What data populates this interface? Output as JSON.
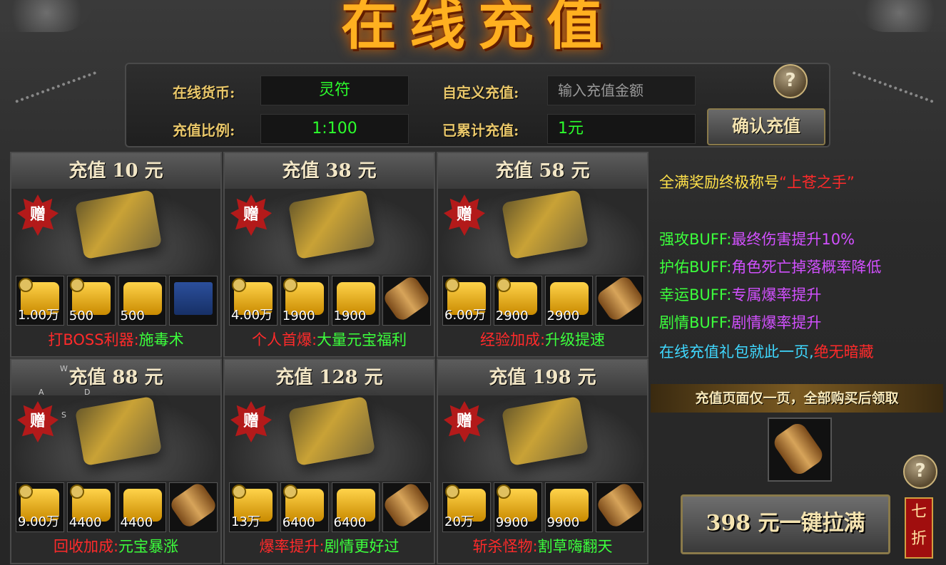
{
  "title": "在线充值",
  "panel": {
    "currency_label": "在线货币:",
    "currency_value": "灵符",
    "ratio_label": "充值比例:",
    "ratio_value": "1:100",
    "custom_label": "自定义充值:",
    "custom_placeholder": "输入充值金额",
    "accum_label": "已累计充值:",
    "accum_value": "1元",
    "confirm_button": "确认充值",
    "help": "?"
  },
  "cards": [
    {
      "title": "充值 10 元",
      "gift": "赠",
      "slots": [
        {
          "icon": "gold-ingot-icon",
          "qty": "1.00万",
          "lock": true
        },
        {
          "icon": "gold-talisman-icon",
          "qty": "500",
          "lock": true
        },
        {
          "icon": "gold-talisman-icon",
          "qty": "500",
          "lock": false
        },
        {
          "icon": "skill-book-icon",
          "qty": "",
          "lock": false
        }
      ],
      "desc_a": "打BOSS利器:",
      "desc_b": "施毒术"
    },
    {
      "title": "充值 38 元",
      "gift": "赠",
      "slots": [
        {
          "icon": "gold-ingot-icon",
          "qty": "4.00万",
          "lock": true
        },
        {
          "icon": "gold-talisman-icon",
          "qty": "1900",
          "lock": true
        },
        {
          "icon": "gold-talisman-icon",
          "qty": "1900",
          "lock": false
        },
        {
          "icon": "scroll-icon",
          "qty": "",
          "lock": false
        }
      ],
      "desc_a": "个人首爆:",
      "desc_b": "大量元宝福利"
    },
    {
      "title": "充值 58 元",
      "gift": "赠",
      "slots": [
        {
          "icon": "gold-ingot-icon",
          "qty": "6.00万",
          "lock": true
        },
        {
          "icon": "gold-talisman-icon",
          "qty": "2900",
          "lock": true
        },
        {
          "icon": "gold-talisman-icon",
          "qty": "2900",
          "lock": false
        },
        {
          "icon": "scroll-icon",
          "qty": "",
          "lock": false
        }
      ],
      "desc_a": "经验加成:",
      "desc_b": "升级提速"
    },
    {
      "title": "充值 88 元",
      "gift": "赠",
      "slots": [
        {
          "icon": "gold-ingot-icon",
          "qty": "9.00万",
          "lock": true
        },
        {
          "icon": "gold-talisman-icon",
          "qty": "4400",
          "lock": true
        },
        {
          "icon": "gold-talisman-icon",
          "qty": "4400",
          "lock": false
        },
        {
          "icon": "scroll-icon",
          "qty": "",
          "lock": false
        }
      ],
      "desc_a": "回收加成:",
      "desc_b": "元宝暴涨"
    },
    {
      "title": "充值 128 元",
      "gift": "赠",
      "slots": [
        {
          "icon": "gold-ingot-icon",
          "qty": "13万",
          "lock": true
        },
        {
          "icon": "gold-talisman-icon",
          "qty": "6400",
          "lock": true
        },
        {
          "icon": "gold-talisman-icon",
          "qty": "6400",
          "lock": false
        },
        {
          "icon": "scroll-icon",
          "qty": "",
          "lock": false
        }
      ],
      "desc_a": "爆率提升:",
      "desc_b": "剧情更好过"
    },
    {
      "title": "充值 198 元",
      "gift": "赠",
      "slots": [
        {
          "icon": "gold-ingot-icon",
          "qty": "20万",
          "lock": true
        },
        {
          "icon": "gold-talisman-icon",
          "qty": "9900",
          "lock": true
        },
        {
          "icon": "gold-talisman-icon",
          "qty": "9900",
          "lock": false
        },
        {
          "icon": "scroll-icon",
          "qty": "",
          "lock": false
        }
      ],
      "desc_a": "斩杀怪物:",
      "desc_b": "割草嗨翻天"
    }
  ],
  "right": {
    "line1_a": "全满奖励终极称号",
    "line1_b": "“上苍之手”",
    "buffs": [
      {
        "name": "强攻BUFF:",
        "effect": "最终伤害提升10%"
      },
      {
        "name": "护佑BUFF:",
        "effect": "角色死亡掉落概率降低"
      },
      {
        "name": "幸运BUFF:",
        "effect": "专属爆率提升"
      },
      {
        "name": "剧情BUFF:",
        "effect": "剧情爆率提升"
      }
    ],
    "note_a": "在线充值礼包就此一页,",
    "note_b": "绝无暗藏",
    "bar_text": "充值页面仅一页，全部购买后领取",
    "help": "?",
    "full_button": "398 元一键拉满",
    "discount": [
      "七",
      "折"
    ]
  },
  "wasd": [
    "W",
    "A",
    "D",
    "S"
  ]
}
